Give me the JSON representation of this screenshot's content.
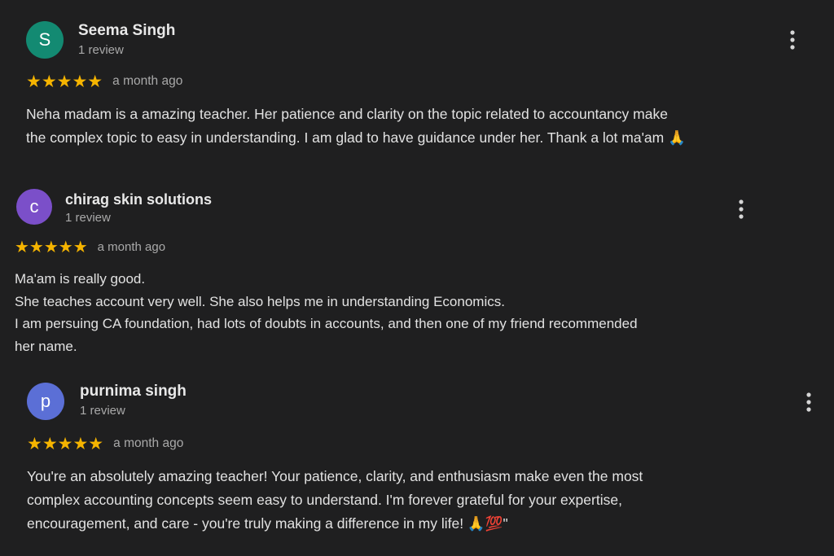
{
  "reviews": [
    {
      "initial": "S",
      "avatar_color": "#138a72",
      "name": "Seema Singh",
      "review_count": "1 review",
      "stars": "★★★★★",
      "time": "a month ago",
      "text_lines": [
        "Neha madam is a amazing teacher. Her patience and clarity on the topic related to accountancy make",
        "the complex topic to easy in understanding. I am glad to have guidance under her. Thank a lot ma'am 🙏"
      ]
    },
    {
      "initial": "c",
      "avatar_color": "#7b4fc9",
      "name": "chirag skin solutions",
      "review_count": "1 review",
      "stars": "★★★★★",
      "time": "a month ago",
      "text_lines": [
        "Ma'am is really good.",
        "She teaches account very well. She also helps me in understanding Economics.",
        "I am persuing CA foundation, had lots of doubts in accounts, and then one of my friend recommended",
        "her name."
      ]
    },
    {
      "initial": "p",
      "avatar_color": "#5b6fd6",
      "name": "purnima singh",
      "review_count": "1 review",
      "stars": "★★★★★",
      "time": "a month ago",
      "text_lines": [
        "You're an absolutely amazing teacher! Your patience, clarity, and enthusiasm make even the most",
        "complex accounting concepts seem easy to understand. I'm forever grateful for your expertise,",
        "encouragement, and care - you're truly making a difference in my life! 🙏💯\""
      ]
    }
  ],
  "icons": {
    "more": "more-vertical-icon",
    "star": "star-icon"
  },
  "colors": {
    "background": "#1f1f20",
    "star": "#f5b400"
  }
}
